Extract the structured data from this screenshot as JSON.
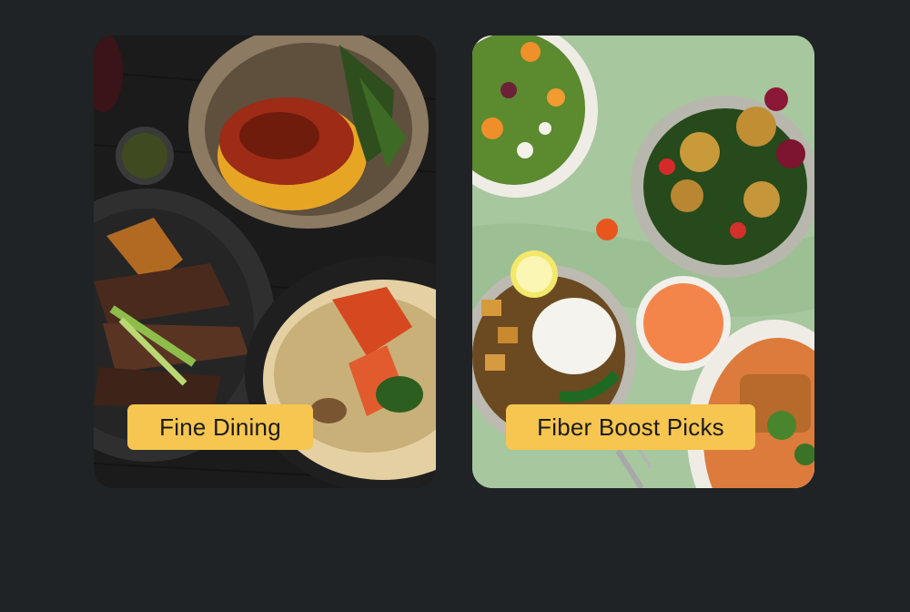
{
  "categories": [
    {
      "label": "Fine Dining",
      "photo": "gourmet-meals-photo",
      "label_bg": "#f7c650"
    },
    {
      "label": "Fiber Boost Picks",
      "photo": "salad-bowls-photo",
      "label_bg": "#f7c650"
    }
  ],
  "colors": {
    "background": "#202326",
    "label_background": "#f7c650",
    "label_text": "#1c1c1c"
  }
}
